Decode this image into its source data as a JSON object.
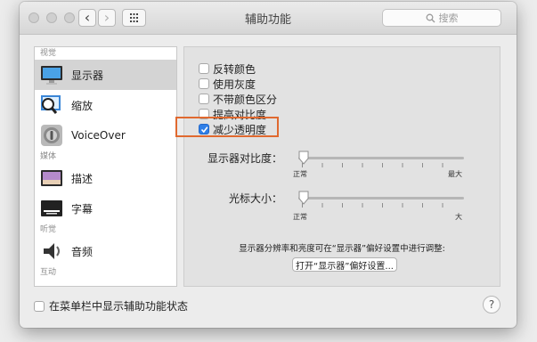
{
  "window": {
    "title": "辅助功能"
  },
  "toolbar": {
    "back_glyph": "‹",
    "forward_glyph": "›",
    "search_placeholder": "搜索"
  },
  "sidebar": {
    "sections": [
      {
        "label": "视觉",
        "items": [
          {
            "label": "显示器",
            "icon": "display-icon",
            "selected": true
          },
          {
            "label": "缩放",
            "icon": "zoom-icon",
            "selected": false
          },
          {
            "label": "VoiceOver",
            "icon": "voiceover-icon",
            "selected": false
          }
        ]
      },
      {
        "label": "媒体",
        "items": [
          {
            "label": "描述",
            "icon": "descriptions-icon",
            "selected": false
          },
          {
            "label": "字幕",
            "icon": "captions-icon",
            "selected": false
          }
        ]
      },
      {
        "label": "听觉",
        "items": [
          {
            "label": "音频",
            "icon": "audio-icon",
            "selected": false
          }
        ]
      },
      {
        "label": "互动",
        "items": []
      }
    ]
  },
  "panel": {
    "options": [
      {
        "label": "反转颜色",
        "checked": false
      },
      {
        "label": "使用灰度",
        "checked": false
      },
      {
        "label": "不带颜色区分",
        "checked": false
      },
      {
        "label": "提高对比度",
        "checked": false
      },
      {
        "label": "减少透明度",
        "checked": true
      }
    ],
    "contrast": {
      "label": "显示器对比度：",
      "min_label": "正常",
      "max_label": "最大",
      "value": 0
    },
    "cursor": {
      "label": "光标大小：",
      "min_label": "正常",
      "max_label": "大",
      "value": 0
    },
    "note": "显示器分辨率和亮度可在“显示器”偏好设置中进行调整:",
    "open_button": "打开“显示器”偏好设置..."
  },
  "footer": {
    "menu_status_label": "在菜单栏中显示辅助功能状态",
    "menu_status_checked": false,
    "help_label": "?"
  }
}
